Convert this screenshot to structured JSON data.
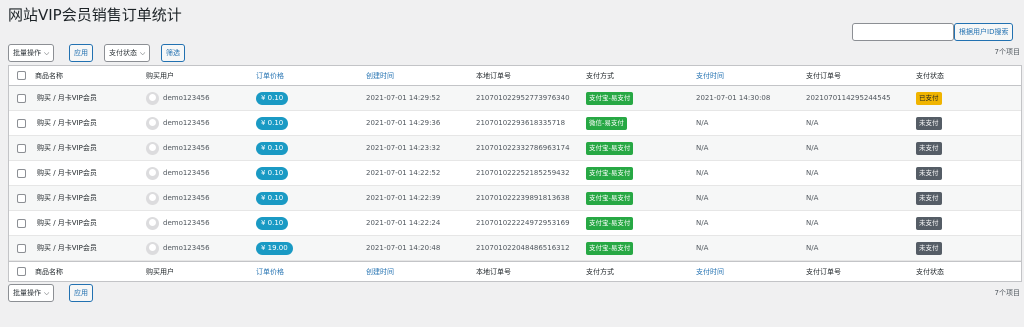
{
  "page": {
    "title": "网站VIP会员销售订单统计",
    "search_button": "根据用户ID搜索",
    "search_value": "",
    "item_count": "7个项目"
  },
  "toolbar_top": {
    "bulk_actions": "批量操作",
    "apply": "应用",
    "pay_status_filter": "支付状态",
    "filter": "筛选"
  },
  "toolbar_bottom": {
    "bulk_actions": "批量操作",
    "apply": "应用"
  },
  "columns": {
    "product": "商品名称",
    "user": "购买用户",
    "price": "订单价格",
    "created": "创建时间",
    "local_order": "本地订单号",
    "pay_method": "支付方式",
    "pay_time": "支付时间",
    "pay_order": "支付订单号",
    "pay_status": "支付状态"
  },
  "rows": [
    {
      "product": "购买 / 月卡VIP会员",
      "user": "demo123456",
      "price": "¥ 0.10",
      "created": "2021-07-01 14:29:52",
      "local_order": "210701022952773976340",
      "pay_method": "支付宝-易支付",
      "pay_time": "2021-07-01 14:30:08",
      "pay_order": "2021070114295244545",
      "status": "已支付"
    },
    {
      "product": "购买 / 月卡VIP会员",
      "user": "demo123456",
      "price": "¥ 0.10",
      "created": "2021-07-01 14:29:36",
      "local_order": "21070102293618335718",
      "pay_method": "微信-易支付",
      "pay_time": "N/A",
      "pay_order": "N/A",
      "status": "未支付"
    },
    {
      "product": "购买 / 月卡VIP会员",
      "user": "demo123456",
      "price": "¥ 0.10",
      "created": "2021-07-01 14:23:32",
      "local_order": "210701022332786963174",
      "pay_method": "支付宝-易支付",
      "pay_time": "N/A",
      "pay_order": "N/A",
      "status": "未支付"
    },
    {
      "product": "购买 / 月卡VIP会员",
      "user": "demo123456",
      "price": "¥ 0.10",
      "created": "2021-07-01 14:22:52",
      "local_order": "210701022252185259432",
      "pay_method": "支付宝-易支付",
      "pay_time": "N/A",
      "pay_order": "N/A",
      "status": "未支付"
    },
    {
      "product": "购买 / 月卡VIP会员",
      "user": "demo123456",
      "price": "¥ 0.10",
      "created": "2021-07-01 14:22:39",
      "local_order": "210701022239891813638",
      "pay_method": "支付宝-易支付",
      "pay_time": "N/A",
      "pay_order": "N/A",
      "status": "未支付"
    },
    {
      "product": "购买 / 月卡VIP会员",
      "user": "demo123456",
      "price": "¥ 0.10",
      "created": "2021-07-01 14:22:24",
      "local_order": "210701022224972953169",
      "pay_method": "支付宝-易支付",
      "pay_time": "N/A",
      "pay_order": "N/A",
      "status": "未支付"
    },
    {
      "product": "购买 / 月卡VIP会员",
      "user": "demo123456",
      "price": "¥ 19.00",
      "created": "2021-07-01 14:20:48",
      "local_order": "210701022048486516312",
      "pay_method": "支付宝-易支付",
      "pay_time": "N/A",
      "pay_order": "N/A",
      "status": "未支付"
    }
  ],
  "colors": {
    "accent": "#2271b1",
    "price_badge": "#1a9ac4",
    "pay_badge": "#27a844",
    "paid_badge": "#f0b400",
    "unpaid_badge": "#555d66"
  }
}
